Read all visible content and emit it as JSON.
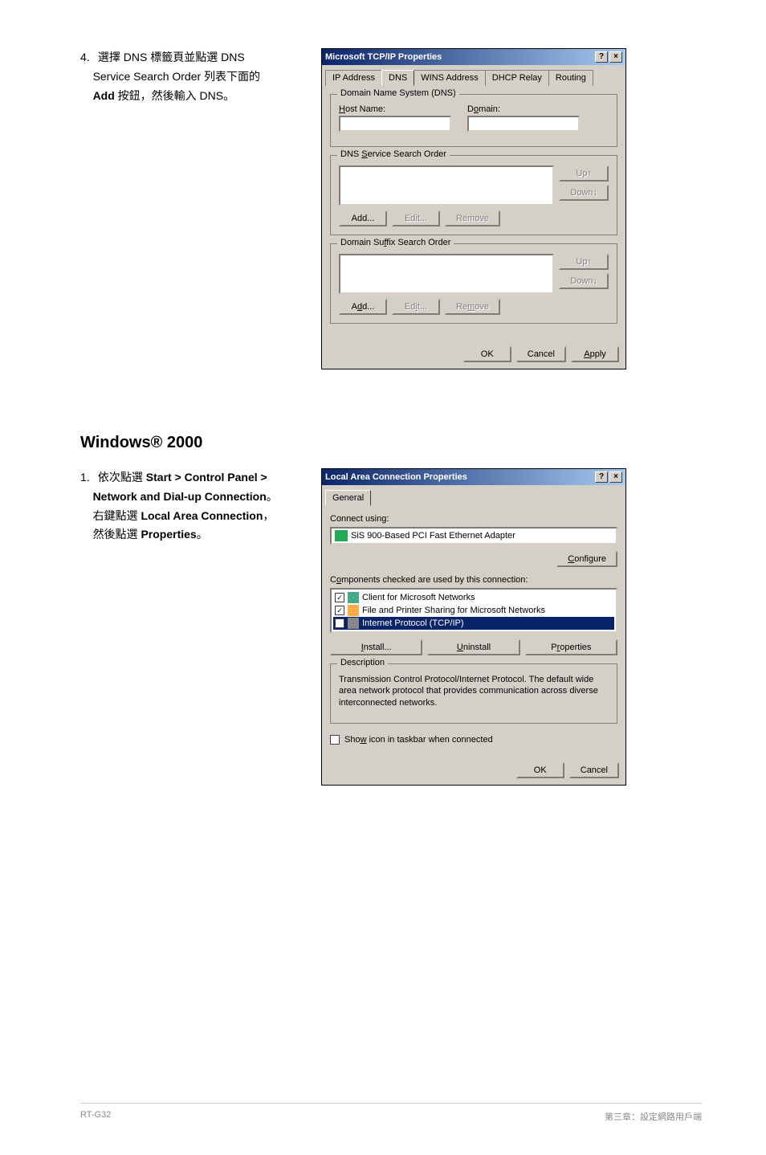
{
  "step4": {
    "num": "4.",
    "text_line1": "選擇 DNS 標籤頁並點選 DNS",
    "text_line2": "Service Search Order 列表下面的",
    "text_line3_bold": "Add",
    "text_line3_rest": " 按鈕，然後輸入 DNS。"
  },
  "dialog1": {
    "title": "Microsoft TCP/IP Properties",
    "tabs": {
      "ip": "IP Address",
      "dns": "DNS",
      "wins": "WINS Address",
      "dhcp": "DHCP Relay",
      "routing": "Routing"
    },
    "group1_title": "Domain Name System (DNS)",
    "host_label": "Host Name:",
    "domain_label": "Domain:",
    "group2_title": "DNS Service Search Order",
    "group3_title": "Domain Suffix Search Order",
    "btn_up": "Up↑",
    "btn_down": "Down↓",
    "btn_add": "Add...",
    "btn_edit": "Edit...",
    "btn_remove": "Remove",
    "btn_ok": "OK",
    "btn_cancel": "Cancel",
    "btn_apply": "Apply"
  },
  "heading2": "Windows® 2000",
  "step1": {
    "num": "1.",
    "line1_a": "依次點選 ",
    "line1_b": "Start > Control Panel >",
    "line2_b": "Network and Dial-up Connection",
    "line2_c": "。",
    "line3_a": "右鍵點選 ",
    "line3_b": "Local Area Connection",
    "line3_c": "，",
    "line4_a": "然後點選 ",
    "line4_b": "Properties",
    "line4_c": "。"
  },
  "dialog2": {
    "title": "Local Area Connection Properties",
    "tab_general": "General",
    "connect_using": "Connect using:",
    "adapter": "SiS 900-Based PCI Fast Ethernet Adapter",
    "btn_configure": "Configure",
    "components_label": "Components checked are used by this connection:",
    "comp1": "Client for Microsoft Networks",
    "comp2": "File and Printer Sharing for Microsoft Networks",
    "comp3": "Internet Protocol (TCP/IP)",
    "btn_install": "Install...",
    "btn_uninstall": "Uninstall",
    "btn_properties": "Properties",
    "desc_label": "Description",
    "desc_text": "Transmission Control Protocol/Internet Protocol. The default wide area network protocol that provides communication across diverse interconnected networks.",
    "show_icon": "Show icon in taskbar when connected",
    "btn_ok": "OK",
    "btn_cancel": "Cancel"
  },
  "footer": {
    "left": "RT-G32",
    "right": "第三章：設定網路用戶端"
  }
}
